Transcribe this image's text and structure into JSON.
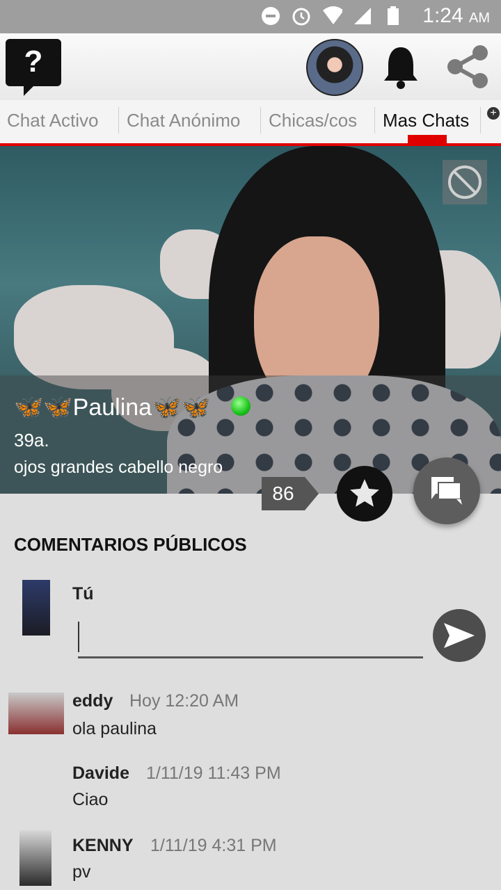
{
  "status_bar": {
    "time": "1:24",
    "ampm": "AM"
  },
  "tabs": [
    {
      "label": "Chat Activo"
    },
    {
      "label": "Chat Anónimo"
    },
    {
      "label": "Chicas/cos"
    },
    {
      "label": "Mas Chats"
    }
  ],
  "profile": {
    "name": "🦋🦋Paulina🦋🦋",
    "age": "39a.",
    "description": "ojos grandes cabello negro",
    "likes_count": "86"
  },
  "comments_section": {
    "title": "COMENTARIOS PÚBLICOS",
    "me_label": "Tú",
    "input_value": ""
  },
  "comments": [
    {
      "author": "eddy",
      "time": "Hoy 12:20 AM",
      "text": "ola paulina"
    },
    {
      "author": "Davide",
      "time": "1/11/19 11:43 PM",
      "text": "Ciao"
    },
    {
      "author": "KENNY",
      "time": "1/11/19 4:31 PM",
      "text": "pv"
    }
  ],
  "colors": {
    "accent": "#e00000",
    "online": "#19c21a"
  },
  "icons": [
    "help-icon",
    "notifications-icon",
    "share-icon",
    "block-icon",
    "star-icon",
    "chat-icon",
    "send-icon",
    "add-tab-icon"
  ]
}
